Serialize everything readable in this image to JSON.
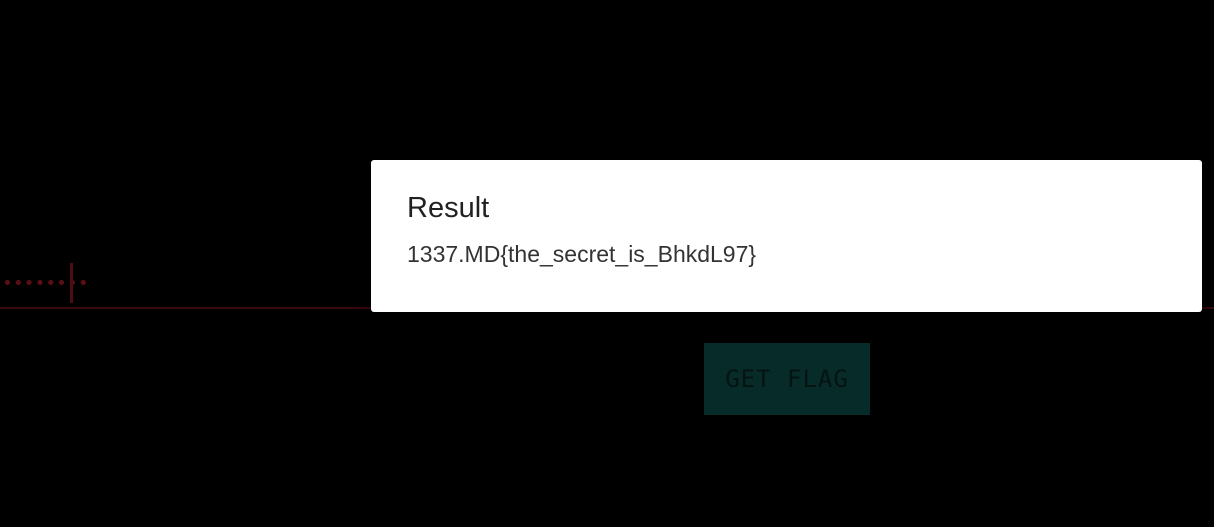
{
  "form": {
    "password_mask": "••••••••",
    "get_flag_label": "GET FLAG"
  },
  "dialog": {
    "title": "Result",
    "message": "1337.MD{the_secret_is_BhkdL97}"
  },
  "colors": {
    "background": "#000000",
    "dialog_background": "#ffffff",
    "button_background": "#062b28",
    "underline": "#3a080d"
  }
}
